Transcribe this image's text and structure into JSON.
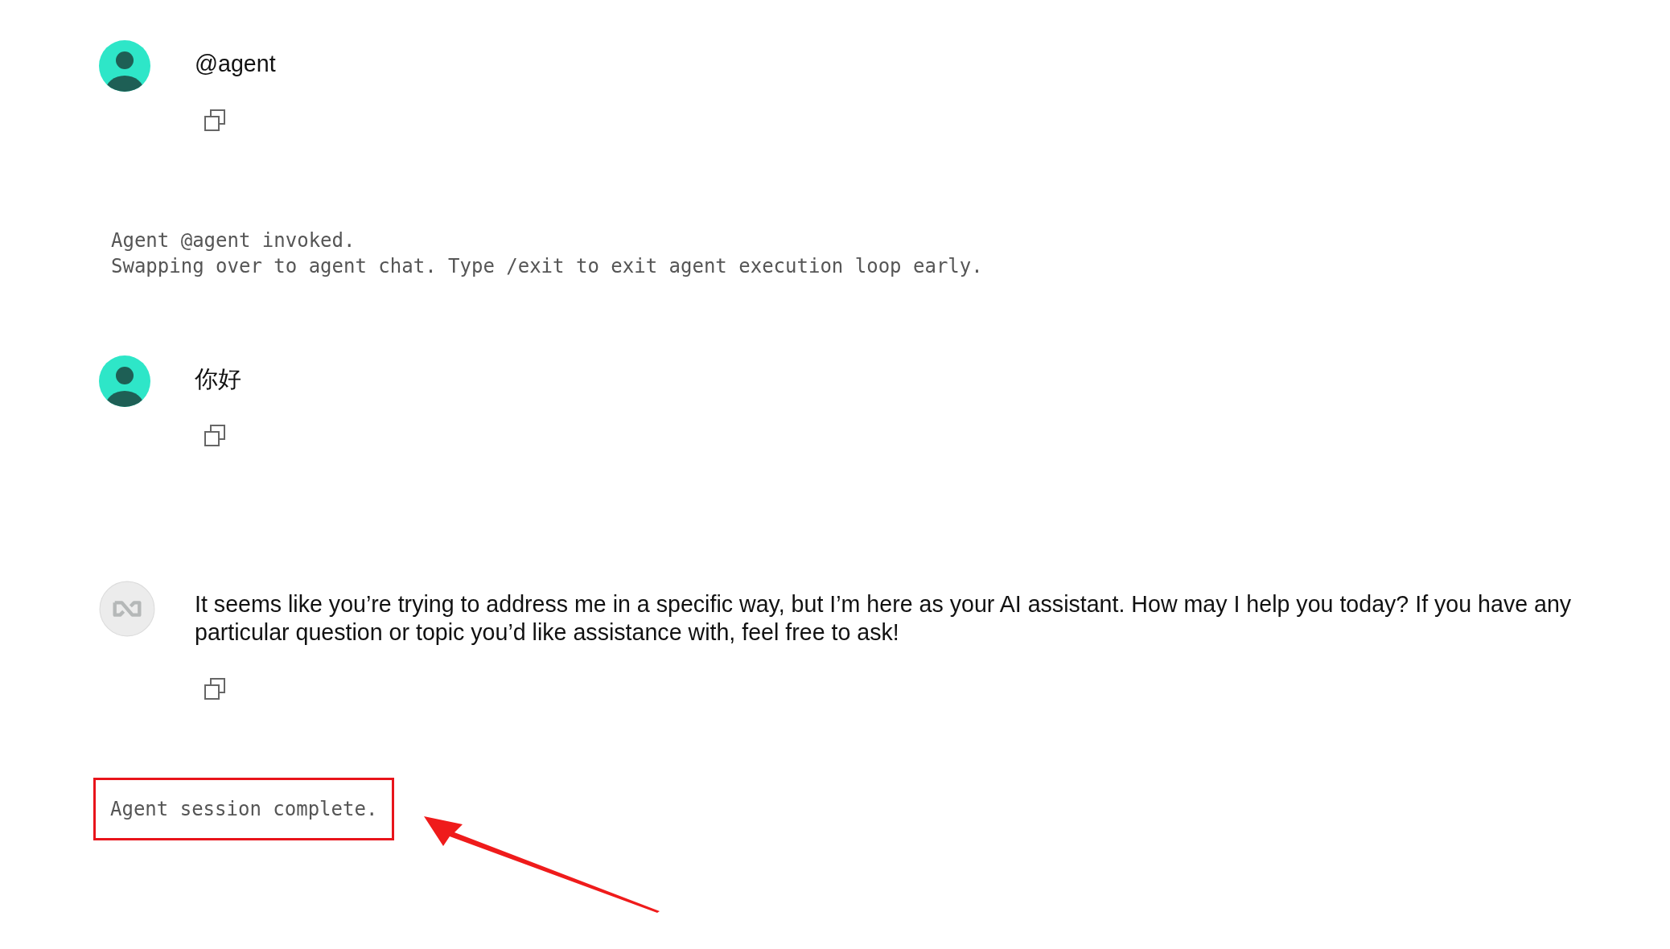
{
  "messages": [
    {
      "kind": "user",
      "text": "@agent"
    },
    {
      "kind": "system",
      "lines": [
        "Agent @agent invoked.",
        "Swapping over to agent chat. Type /exit to exit agent execution loop early."
      ],
      "highlighted": false
    },
    {
      "kind": "user",
      "text": "你好"
    },
    {
      "kind": "assistant",
      "text": "It seems like you’re trying to address me in a specific way, but I’m here as your AI assistant. How may I help you today? If you have any particular question or topic you’d like assistance with, feel free to ask!"
    },
    {
      "kind": "system",
      "lines": [
        "Agent session complete."
      ],
      "highlighted": true
    }
  ]
}
